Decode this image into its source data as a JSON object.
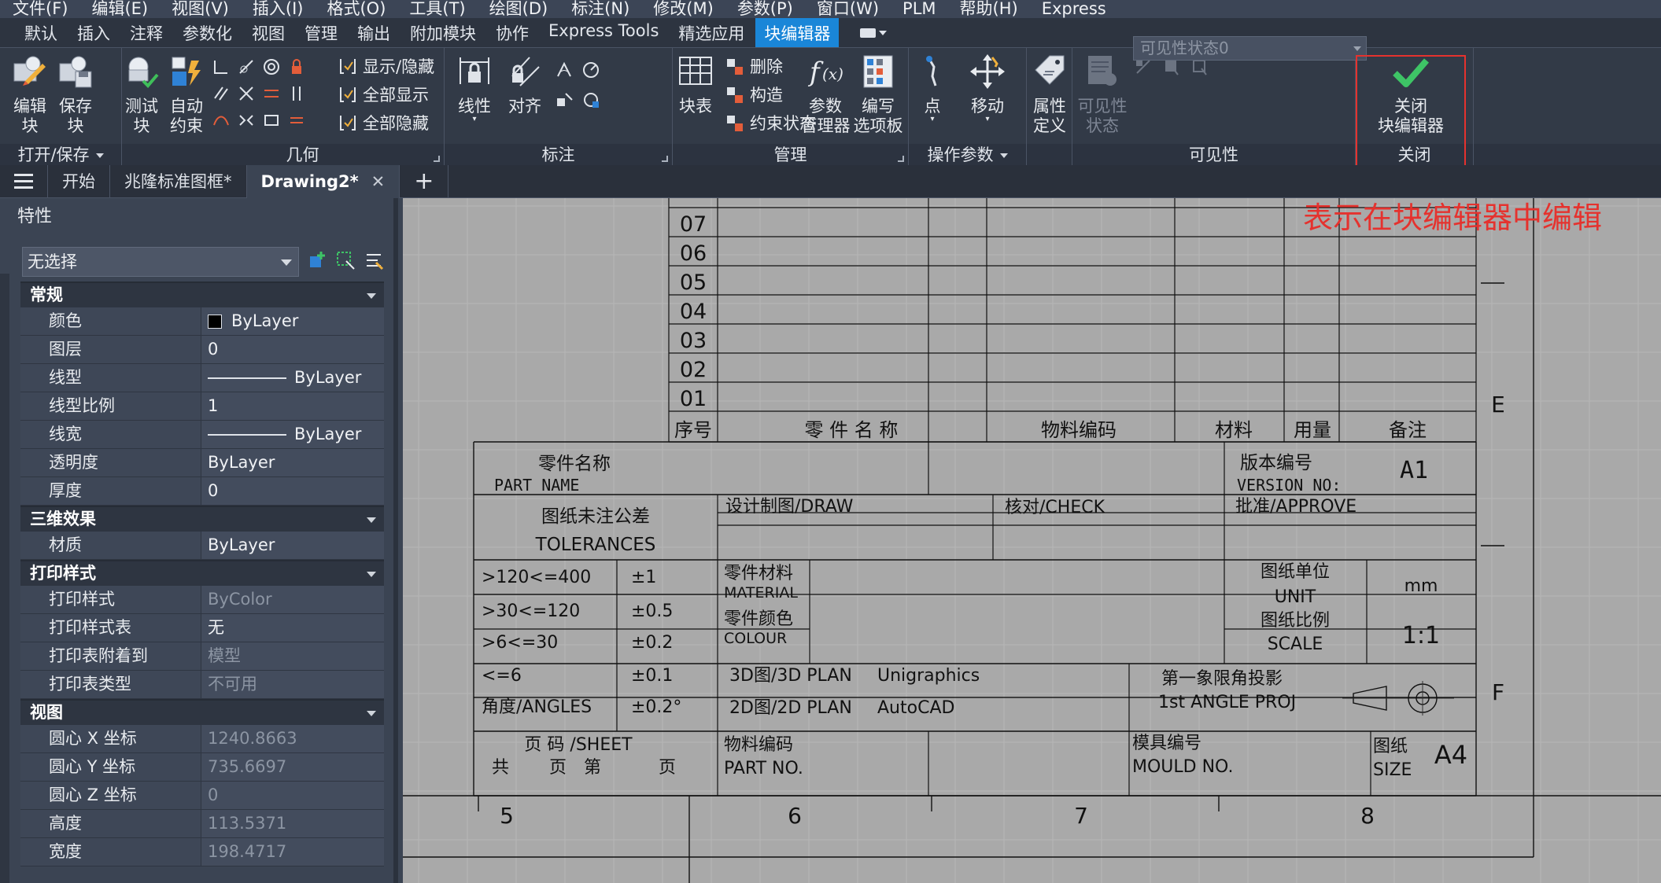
{
  "menu": [
    "文件(F)",
    "编辑(E)",
    "视图(V)",
    "插入(I)",
    "格式(O)",
    "工具(T)",
    "绘图(D)",
    "标注(N)",
    "修改(M)",
    "参数(P)",
    "窗口(W)",
    "PLM",
    "帮助(H)",
    "Express"
  ],
  "tabs": [
    "默认",
    "插入",
    "注释",
    "参数化",
    "视图",
    "管理",
    "输出",
    "附加模块",
    "协作",
    "Express Tools",
    "精选应用",
    "块编辑器"
  ],
  "active_tab": "块编辑器",
  "ribbon": {
    "open_save": {
      "title": "打开/保存",
      "edit_block": "编辑\n块",
      "save_block": "保存\n块"
    },
    "test_block": "测试\n块",
    "geometry": {
      "title": "几何",
      "auto_constrain": "自动\n约束",
      "show_hide": "显示/隐藏",
      "show_all": "全部显示",
      "hide_all": "全部隐藏"
    },
    "dimension": {
      "title": "标注",
      "linear": "线性",
      "aligned": "对齐"
    },
    "manage": {
      "title": "管理",
      "block_table": "块表",
      "delete": "删除",
      "construct": "构造",
      "constraint_status": "约束状态",
      "param_manager": "参数\n管理器",
      "authoring_palettes": "编写\n选项板"
    },
    "action_params": {
      "title": "操作参数",
      "point": "点",
      "move": "移动"
    },
    "attribute_def": "属性\n定义",
    "visibility": {
      "title": "可见性",
      "vis_state_btn": "可见性\n状态",
      "vis_state_value": "可见性状态0"
    },
    "close": {
      "title": "关闭",
      "close_label": "关闭\n块编辑器"
    }
  },
  "annotation_text": "表示在块编辑器中编辑",
  "file_tabs": [
    "开始",
    "兆隆标准图框*",
    "Drawing2*"
  ],
  "active_file": "Drawing2*",
  "properties": {
    "title": "特性",
    "selection": "无选择",
    "categories": [
      {
        "name": "常规",
        "rows": [
          {
            "n": "颜色",
            "v": "ByLayer",
            "kind": "swatch"
          },
          {
            "n": "图层",
            "v": "0"
          },
          {
            "n": "线型",
            "v": "ByLayer",
            "kind": "line"
          },
          {
            "n": "线型比例",
            "v": "1"
          },
          {
            "n": "线宽",
            "v": "ByLayer",
            "kind": "line"
          },
          {
            "n": "透明度",
            "v": "ByLayer"
          },
          {
            "n": "厚度",
            "v": "0"
          }
        ]
      },
      {
        "name": "三维效果",
        "rows": [
          {
            "n": "材质",
            "v": "ByLayer"
          }
        ]
      },
      {
        "name": "打印样式",
        "rows": [
          {
            "n": "打印样式",
            "v": "ByColor",
            "dim": true
          },
          {
            "n": "打印样式表",
            "v": "无"
          },
          {
            "n": "打印表附着到",
            "v": "模型",
            "dim": true
          },
          {
            "n": "打印表类型",
            "v": "不可用",
            "dim": true
          }
        ]
      },
      {
        "name": "视图",
        "rows": [
          {
            "n": "圆心 X 坐标",
            "v": "1240.8663",
            "dim": true
          },
          {
            "n": "圆心 Y 坐标",
            "v": "735.6697",
            "dim": true
          },
          {
            "n": "圆心 Z 坐标",
            "v": "0",
            "dim": true
          },
          {
            "n": "高度",
            "v": "113.5371",
            "dim": true
          },
          {
            "n": "宽度",
            "v": "198.4717",
            "dim": true
          }
        ]
      }
    ]
  },
  "drawing": {
    "bom_row_numbers": [
      "07",
      "06",
      "05",
      "04",
      "03",
      "02",
      "01"
    ],
    "bom_headers": [
      "序号",
      "零 件 名 称",
      "物料编码",
      "材料",
      "用量",
      "备注"
    ],
    "zone_letters": [
      "E",
      "F"
    ],
    "column_numbers": [
      "5",
      "6",
      "7",
      "8"
    ],
    "title_block": {
      "part_name_cn": "零件名称",
      "part_name_en": "PART NAME",
      "version_cn": "版本编号",
      "version_en": "VERSION NO:",
      "version_value": "A1",
      "tolerance_cn": "图纸未注公差",
      "tolerance_en": "TOLERANCES",
      "draw": "设计制图/DRAW",
      "check": "核对/CHECK",
      "approve": "批准/APPROVE",
      "tol_rows": [
        {
          "range": ">120<=400",
          "tol": "±1"
        },
        {
          "range": ">30<=120",
          "tol": "±0.5"
        },
        {
          "range": ">6<=30",
          "tol": "±0.2"
        },
        {
          "range": "<=6",
          "tol": "±0.1"
        },
        {
          "range": "角度/ANGLES",
          "tol": "±0.2°"
        }
      ],
      "material_cn": "零件材料",
      "material_en": "MATERIAL",
      "colour_cn": "零件颜色",
      "colour_en": "COLOUR",
      "unit_cn": "图纸单位",
      "unit_en": "UNIT",
      "unit_value": "mm",
      "scale_cn": "图纸比例",
      "scale_en": "SCALE",
      "scale_value": "1:1",
      "plan3d": "3D图/3D PLAN",
      "plan3d_value": "Unigraphics",
      "plan2d": "2D图/2D PLAN",
      "plan2d_value": "AutoCAD",
      "projection_cn": "第一象限角投影",
      "projection_en": "1st ANGLE PROJ",
      "sheet_label": "页 码 /SHEET",
      "sheet_line": "共　　 页　第　　　 页",
      "part_no_cn": "物料编码",
      "part_no_en": "PART NO.",
      "mould_cn": "模具编号",
      "mould_en": "MOULD NO.",
      "size_cn": "图纸",
      "size_en": "SIZE",
      "size_value": "A4"
    }
  }
}
